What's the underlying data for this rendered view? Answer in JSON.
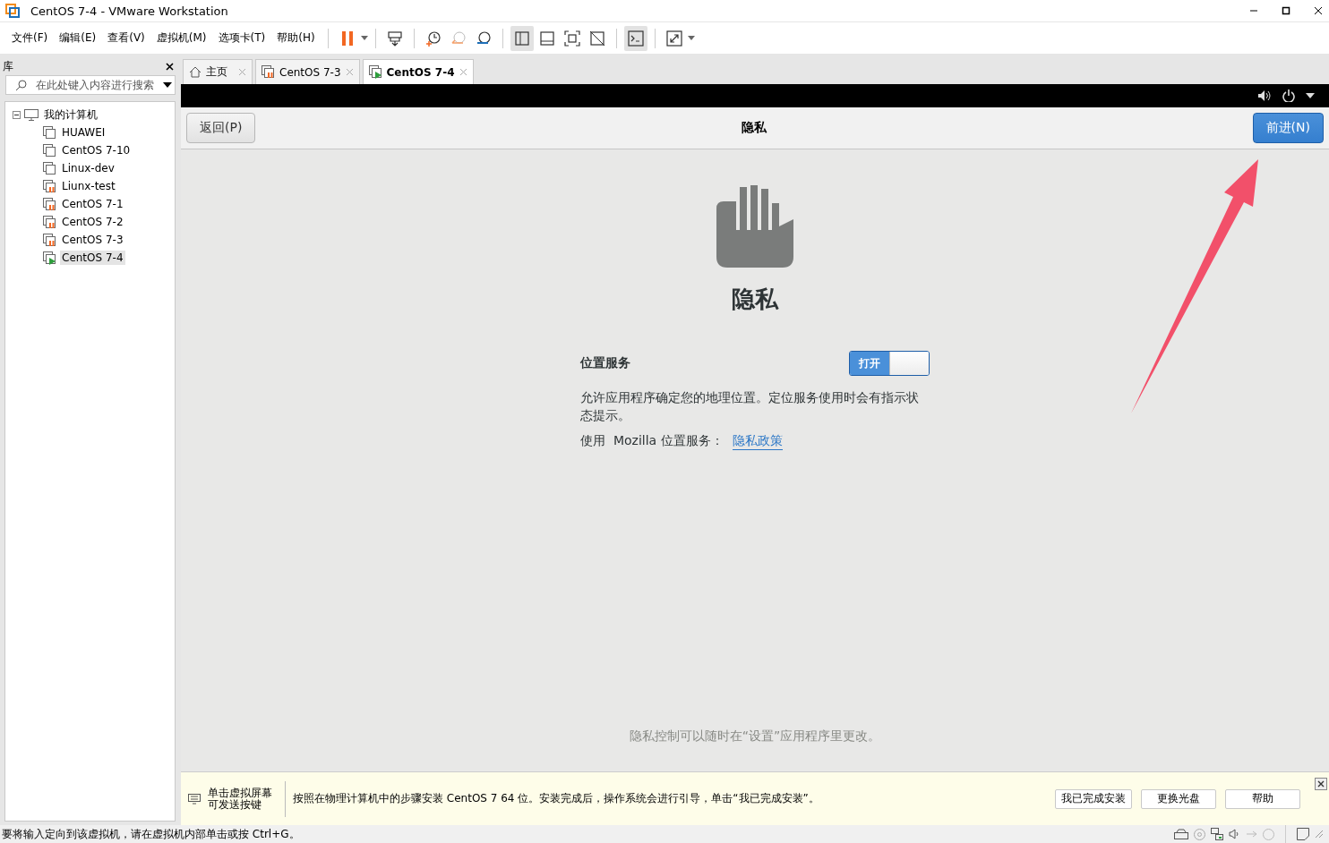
{
  "window": {
    "title": "CentOS 7-4 - VMware Workstation"
  },
  "menu": [
    "文件(F)",
    "编辑(E)",
    "查看(V)",
    "虚拟机(M)",
    "选项卡(T)",
    "帮助(H)"
  ],
  "library": {
    "title": "库",
    "search": {
      "placeholder": "在此处键入内容进行搜索"
    },
    "tree": [
      {
        "label": "我的计算机",
        "expanded": true,
        "selected": false,
        "children": [
          {
            "label": "HUAWEI",
            "kind": "stopped",
            "selected": false
          },
          {
            "label": "CentOS 7-10",
            "kind": "stopped",
            "selected": false
          },
          {
            "label": "Linux-dev",
            "kind": "stopped",
            "selected": false
          },
          {
            "label": "Liunx-test",
            "kind": "suspended",
            "selected": false
          },
          {
            "label": "CentOS 7-1",
            "kind": "suspended",
            "selected": false
          },
          {
            "label": "CentOS 7-2",
            "kind": "suspended",
            "selected": false
          },
          {
            "label": "CentOS 7-3",
            "kind": "suspended",
            "selected": false
          },
          {
            "label": "CentOS 7-4",
            "kind": "running",
            "selected": true
          }
        ]
      }
    ]
  },
  "tabs": [
    {
      "label": "主页",
      "kind": "home",
      "selected": false
    },
    {
      "label": "CentOS 7-3",
      "kind": "suspended",
      "selected": false
    },
    {
      "label": "CentOS 7-4",
      "kind": "running",
      "selected": true
    }
  ],
  "installer": {
    "back_button": "返回(P)",
    "title": "隐私",
    "next_button": "前进(N)",
    "heading": "隐私",
    "location": {
      "label": "位置服务",
      "switch": {
        "label": "打开",
        "on": true
      },
      "description": "允许应用程序确定您的地理位置。定位服务使用时会有指示状态提示。",
      "provider": "使用  Mozilla 位置服务：",
      "link": "隐私政策"
    },
    "footer": "隐私控制可以随时在“设置”应用程序里更改。"
  },
  "notification": {
    "hint": [
      "单击虚拟屏幕",
      "可发送按键"
    ],
    "message": "按照在物理计算机中的步骤安装 CentOS 7 64 位。安装完成后，操作系统会进行引导，单击“我已完成安装”。",
    "buttons": [
      "我已完成安装",
      "更换光盘",
      "帮助"
    ]
  },
  "status_bar": {
    "text": "要将输入定向到该虚拟机，请在虚拟机内部单击或按 Ctrl+G。"
  }
}
